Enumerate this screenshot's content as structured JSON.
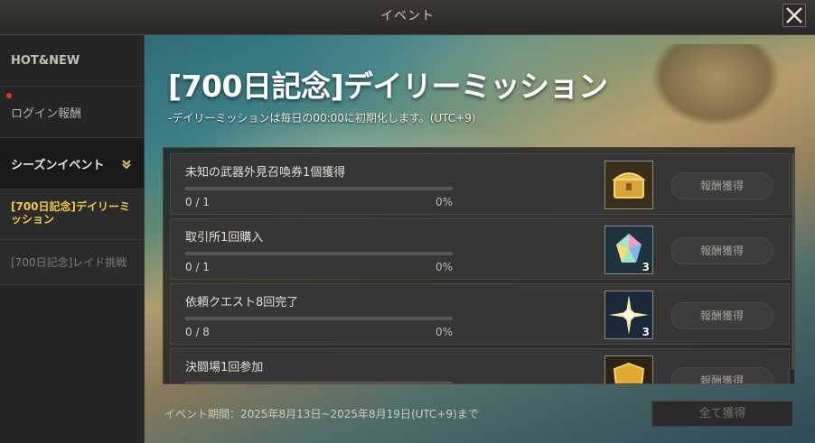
{
  "window": {
    "title": "イベント"
  },
  "sidebar": {
    "items": [
      {
        "label": "HOT&NEW"
      },
      {
        "label": "ログイン報酬"
      },
      {
        "label": "シーズンイベント"
      }
    ],
    "sub_items": [
      {
        "label": "[700日記念]デイリーミッション"
      },
      {
        "label": "[700日記念]レイド挑戦"
      }
    ]
  },
  "banner": {
    "title": "[700日記念]デイリーミッション",
    "subtitle": "-デイリーミッションは毎日の00:00に初期化します。(UTC+9)"
  },
  "missions": [
    {
      "title": "未知の武器外見召喚券1個獲得",
      "count": "0 / 1",
      "percent": "0%",
      "progress": 0,
      "reward_icon": "golden-chest-icon",
      "reward_qty": "",
      "claim_label": "報酬獲得"
    },
    {
      "title": "取引所1回購入",
      "count": "0 / 1",
      "percent": "0%",
      "progress": 0,
      "reward_icon": "rainbow-gem-icon",
      "reward_qty": "3",
      "claim_label": "報酬獲得"
    },
    {
      "title": "依頼クエスト8回完了",
      "count": "0 / 8",
      "percent": "0%",
      "progress": 0,
      "reward_icon": "star-light-icon",
      "reward_qty": "3",
      "claim_label": "報酬獲得"
    },
    {
      "title": "決闘場1回参加",
      "count": "",
      "percent": "",
      "progress": 0,
      "reward_icon": "gold-shield-icon",
      "reward_qty": "",
      "claim_label": "報酬獲得"
    }
  ],
  "footer": {
    "period": "イベント期間：2025年8月13日~2025年8月19日(UTC+9)まで",
    "claim_all_label": "全て獲得"
  },
  "colors": {
    "active_accent": "#f1c84a",
    "notification_dot": "#e2362a"
  }
}
